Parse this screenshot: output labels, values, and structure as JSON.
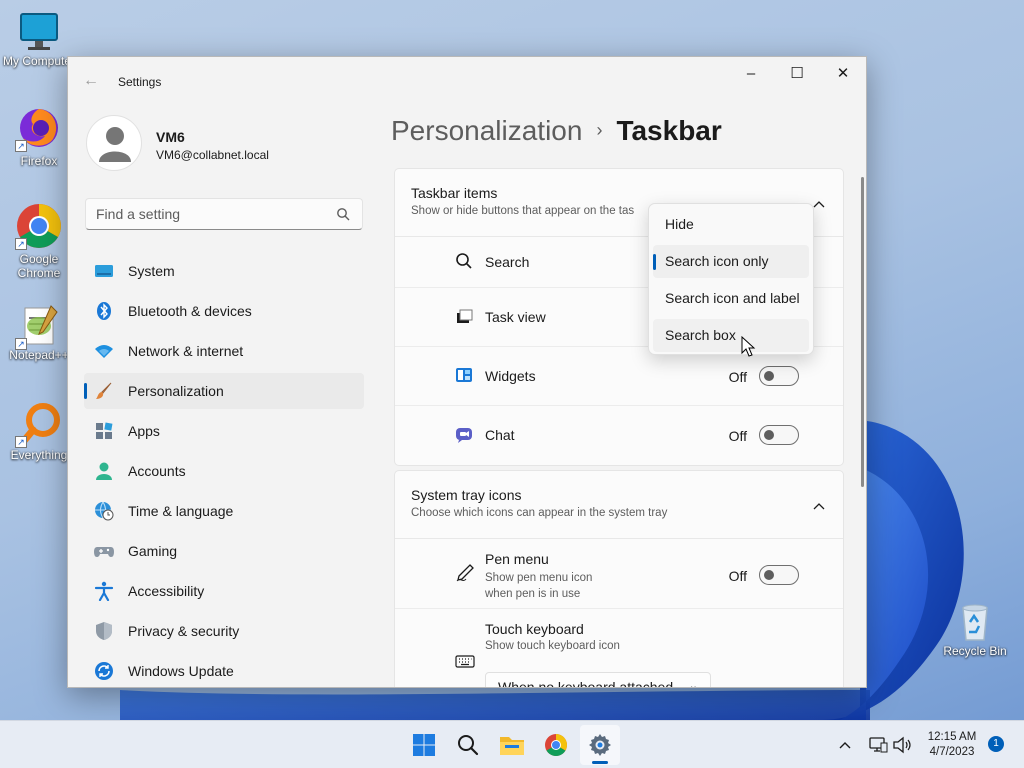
{
  "desktop": {
    "icons": [
      {
        "label": "My Computer"
      },
      {
        "label": "Firefox"
      },
      {
        "label": "Google Chrome"
      },
      {
        "label": "Notepad++"
      },
      {
        "label": "Everything"
      },
      {
        "label": "Recycle Bin"
      }
    ]
  },
  "window": {
    "title": "Settings",
    "back_icon": "back-arrow-icon",
    "controls": {
      "minimize": "–",
      "maximize": "☐",
      "close": "✕"
    }
  },
  "profile": {
    "name": "VM6",
    "email": "VM6@collabnet.local"
  },
  "search": {
    "placeholder": "Find a setting"
  },
  "sidebar": {
    "items": [
      {
        "label": "System",
        "icon": "monitor-icon",
        "active": false
      },
      {
        "label": "Bluetooth & devices",
        "icon": "bluetooth-icon",
        "active": false
      },
      {
        "label": "Network & internet",
        "icon": "wifi-icon",
        "active": false
      },
      {
        "label": "Personalization",
        "icon": "brush-icon",
        "active": true
      },
      {
        "label": "Apps",
        "icon": "apps-icon",
        "active": false
      },
      {
        "label": "Accounts",
        "icon": "person-icon",
        "active": false
      },
      {
        "label": "Time & language",
        "icon": "globe-clock-icon",
        "active": false
      },
      {
        "label": "Gaming",
        "icon": "gamepad-icon",
        "active": false
      },
      {
        "label": "Accessibility",
        "icon": "accessibility-icon",
        "active": false
      },
      {
        "label": "Privacy & security",
        "icon": "shield-icon",
        "active": false
      },
      {
        "label": "Windows Update",
        "icon": "update-icon",
        "active": false
      }
    ]
  },
  "breadcrumb": {
    "parent": "Personalization",
    "separator": "›",
    "current": "Taskbar"
  },
  "taskbar_items": {
    "title": "Taskbar items",
    "subtitle": "Show or hide buttons that appear on the tas",
    "rows": [
      {
        "label": "Search",
        "icon": "search-icon"
      },
      {
        "label": "Task view",
        "icon": "task-view-icon"
      },
      {
        "label": "Widgets",
        "icon": "widgets-icon",
        "state": "Off"
      },
      {
        "label": "Chat",
        "icon": "chat-icon",
        "state": "Off"
      }
    ]
  },
  "search_dropdown": {
    "options": [
      "Hide",
      "Search icon only",
      "Search icon and label",
      "Search box"
    ],
    "selected": "Search icon only",
    "hovered": "Search box"
  },
  "system_tray": {
    "title": "System tray icons",
    "subtitle": "Choose which icons can appear in the system tray",
    "pen": {
      "label": "Pen menu",
      "sub1": "Show pen menu icon",
      "sub2": "when pen is in use",
      "state": "Off"
    },
    "touch": {
      "label": "Touch keyboard",
      "sub": "Show touch keyboard icon",
      "combo_value": "When no keyboard attached"
    }
  },
  "taskbar": {
    "time": "12:15 AM",
    "date": "4/7/2023",
    "notification_count": "1"
  },
  "colors": {
    "accent": "#005fb8"
  }
}
